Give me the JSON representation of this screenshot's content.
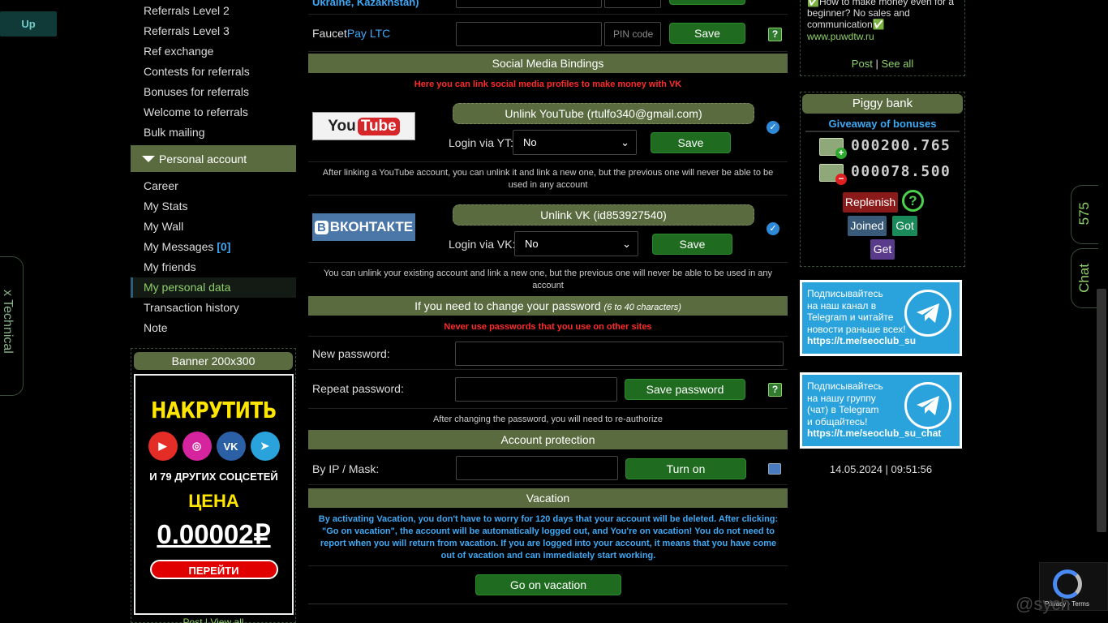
{
  "up_button": "Up",
  "technical_tab": "x Technical",
  "left_menu": {
    "items_top": [
      "Referrals Level 2",
      "Referrals Level 3",
      "Ref exchange",
      "Contests for referrals",
      "Bonuses for referrals",
      "Welcome to referrals",
      "Bulk mailing"
    ],
    "section_header": "Personal account",
    "items": [
      "Career",
      "My Stats",
      "My Wall",
      "My Messages",
      "My friends",
      "My personal data",
      "Transaction history",
      "Note"
    ],
    "messages_count": "[0]"
  },
  "banner": {
    "title": "Banner 200x300",
    "headline": "НАКРУТИТЬ",
    "icons": [
      "youtube-icon",
      "instagram-icon",
      "vk-icon",
      "telegram-icon"
    ],
    "subtitle": "И 79 ДРУГИХ СОЦСЕТЕЙ",
    "price_label": "ЦЕНА",
    "price": "0.00002₽",
    "go_button": "ПЕРЕЙТИ",
    "footer": "Post | View all"
  },
  "main": {
    "top_row_text": "Ukraine, Kazakhstan)",
    "faucet_label_a": "Faucet",
    "faucet_label_b": "Pay LTC",
    "pin_placeholder": "PIN code",
    "save": "Save",
    "social": {
      "title": "Social Media Bindings",
      "note": "Here you can link social media profiles to make money with VK",
      "youtube_logo_a": "You",
      "youtube_logo_b": "Tube",
      "youtube_unlink": "Unlink YouTube (rtulfo340@gmail.com)",
      "youtube_login_label": "Login via YT:",
      "youtube_login_value": "No",
      "youtube_note": "After linking a YouTube account, you can unlink it and link a new one, but the previous one will never be able to be used in any account",
      "vk_logo": "ВКОНТАКТЕ",
      "vk_unlink": "Unlink VK (id853927540)",
      "vk_login_label": "Login via VK:",
      "vk_login_value": "No",
      "vk_note": "You can unlink your existing account and link a new one, but the previous one will never be able to be used in any account"
    },
    "password": {
      "title": "If you need to change your password",
      "title_hint": "(6 to 40 characters)",
      "warning": "Never use passwords that you use on other sites",
      "new_label": "New password:",
      "repeat_label": "Repeat password:",
      "save_button": "Save password",
      "note": "After changing the password, you will need to re-authorize"
    },
    "protection": {
      "title": "Account protection",
      "label": "By IP / Mask:",
      "button": "Turn on"
    },
    "vacation": {
      "title": "Vacation",
      "text": "By activating Vacation, you don't have to worry for 120 days that your account will be deleted. After clicking: \"Go on vacation\", the account will be automatically logged out, and You're on vacation! You do not need to report when you will return from vacation. If you are logged into your account, it means that you have come out of vacation and can immediately start working.",
      "button": "Go on vacation"
    }
  },
  "right": {
    "news_text": "How to make money even for a beginner? No sales and communication",
    "news_link": "www.puwdtw.ru",
    "news_post": "Post",
    "news_sep": "|",
    "news_see_all": "See all",
    "piggy": {
      "title": "Piggy bank",
      "giveaway": "Giveaway of bonuses",
      "value1": "000200.765",
      "value2": "000078.500",
      "replenish": "Replenish",
      "joined": "Joined",
      "got": "Got",
      "get": "Get"
    },
    "tg1": {
      "lines": [
        "Подписывайтесь",
        "на наш канал в",
        "Telegram и читайте",
        "новости раньше всех!"
      ],
      "link": "https://t.me/seoclub_su"
    },
    "tg2": {
      "lines": [
        "Подписывайтесь",
        "на нашу группу",
        "(чат) в Telegram",
        "и общайтесь!"
      ],
      "link": "https://t.me/seoclub_su_chat"
    },
    "datetime": "14.05.2024 | 09:51:56"
  },
  "side_tabs": {
    "count": "575",
    "chat": "Chat"
  },
  "recaptcha_text": "Privacy - Terms",
  "watermark": "@sych",
  "colors": {
    "olive": "#5a6b3f",
    "green_button": "#1f6b1f",
    "accent_blue": "#3fa9f5",
    "warning_red": "#ff2a2a",
    "telegram_blue": "#2aa3dc"
  }
}
